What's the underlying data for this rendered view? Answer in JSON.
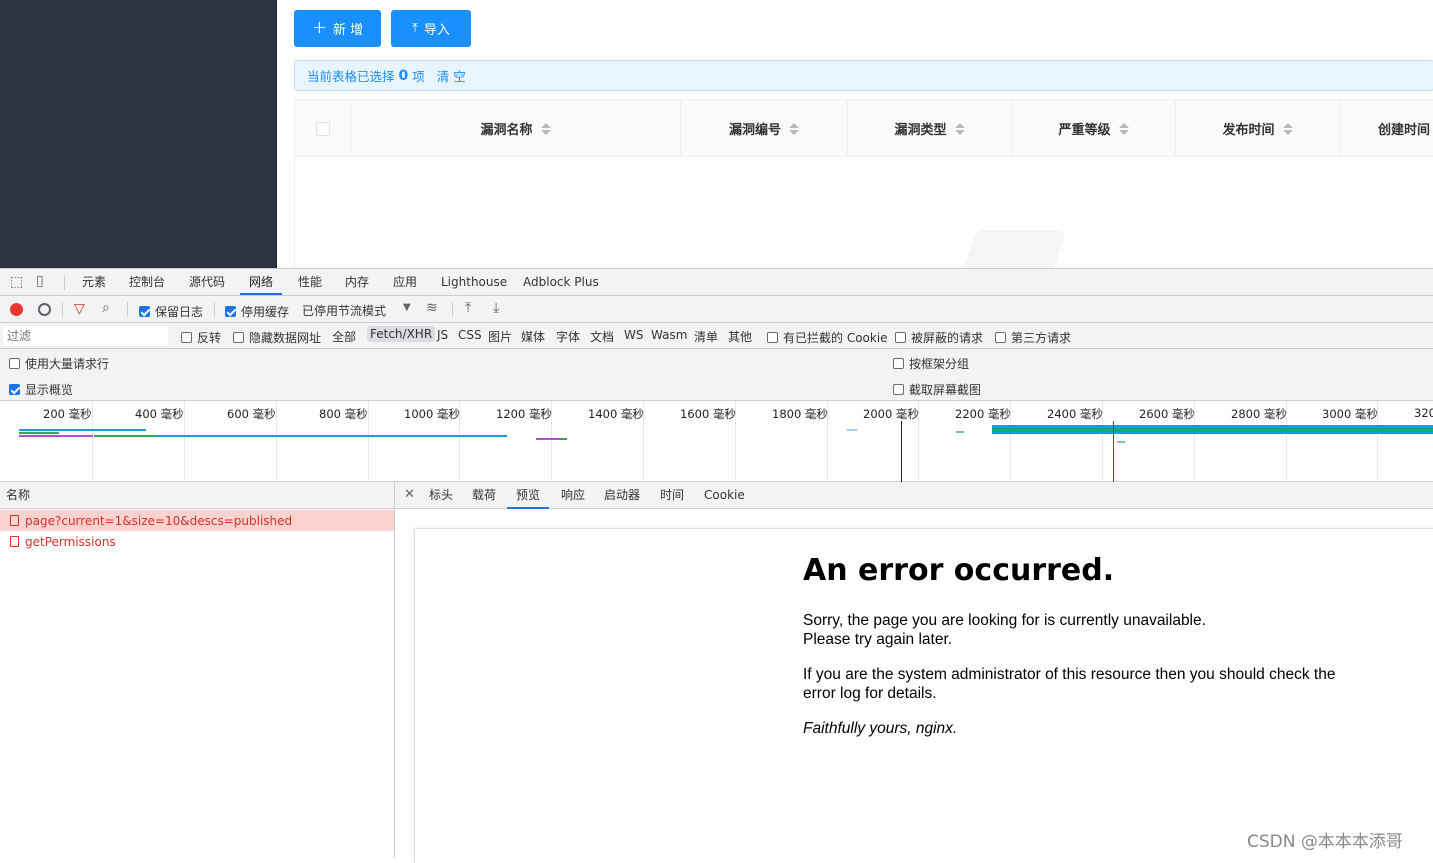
{
  "app": {
    "add_button": "新 增",
    "import_button": "导入",
    "selection": {
      "prefix": "当前表格已选择",
      "count": "0",
      "suffix": "项",
      "clear": "清 空"
    },
    "columns": [
      "漏洞名称",
      "漏洞编号",
      "漏洞类型",
      "严重等级",
      "发布时间",
      "创建时间"
    ]
  },
  "devtools": {
    "tabs": [
      "元素",
      "控制台",
      "源代码",
      "网络",
      "性能",
      "内存",
      "应用",
      "Lighthouse",
      "Adblock Plus"
    ],
    "active_tab": "网络",
    "netbar": {
      "preserve_log": "保留日志",
      "disable_cache": "停用缓存",
      "throttle": "已停用节流模式"
    },
    "filter": {
      "placeholder": "过滤",
      "invert": "反转",
      "hide_data_urls": "隐藏数据网址",
      "types": [
        "全部",
        "Fetch/XHR",
        "JS",
        "CSS",
        "图片",
        "媒体",
        "字体",
        "文档",
        "WS",
        "Wasm",
        "清单",
        "其他"
      ],
      "selected_type": "Fetch/XHR",
      "blocked_cookies": "有已拦截的 Cookie",
      "blocked_requests": "被屏蔽的请求",
      "third_party": "第三方请求"
    },
    "options": {
      "large_rows": "使用大量请求行",
      "group_by_frame": "按框架分组",
      "show_overview": "显示概览",
      "capture_screenshots": "截取屏幕截图"
    },
    "overview_ticks": [
      "200 毫秒",
      "400 毫秒",
      "600 毫秒",
      "800 毫秒",
      "1000 毫秒",
      "1200 毫秒",
      "1400 毫秒",
      "1600 毫秒",
      "1800 毫秒",
      "2000 毫秒",
      "2200 毫秒",
      "2400 毫秒",
      "2600 毫秒",
      "2800 毫秒",
      "3000 毫秒",
      "320"
    ],
    "requests_header": "名称",
    "requests": [
      "page?current=1&size=10&descs=published",
      "getPermissions"
    ],
    "detail_tabs": [
      "标头",
      "载荷",
      "预览",
      "响应",
      "启动器",
      "时间",
      "Cookie"
    ],
    "active_detail_tab": "预览",
    "preview": {
      "title": "An error occurred.",
      "line1": "Sorry, the page you are looking for is currently unavailable.",
      "line2": "Please try again later.",
      "line3": "If you are the system administrator of this resource then you should check the",
      "line4": "error log for details.",
      "line5": "Faithfully yours, nginx."
    }
  },
  "watermark": "CSDN @本本本添哥"
}
